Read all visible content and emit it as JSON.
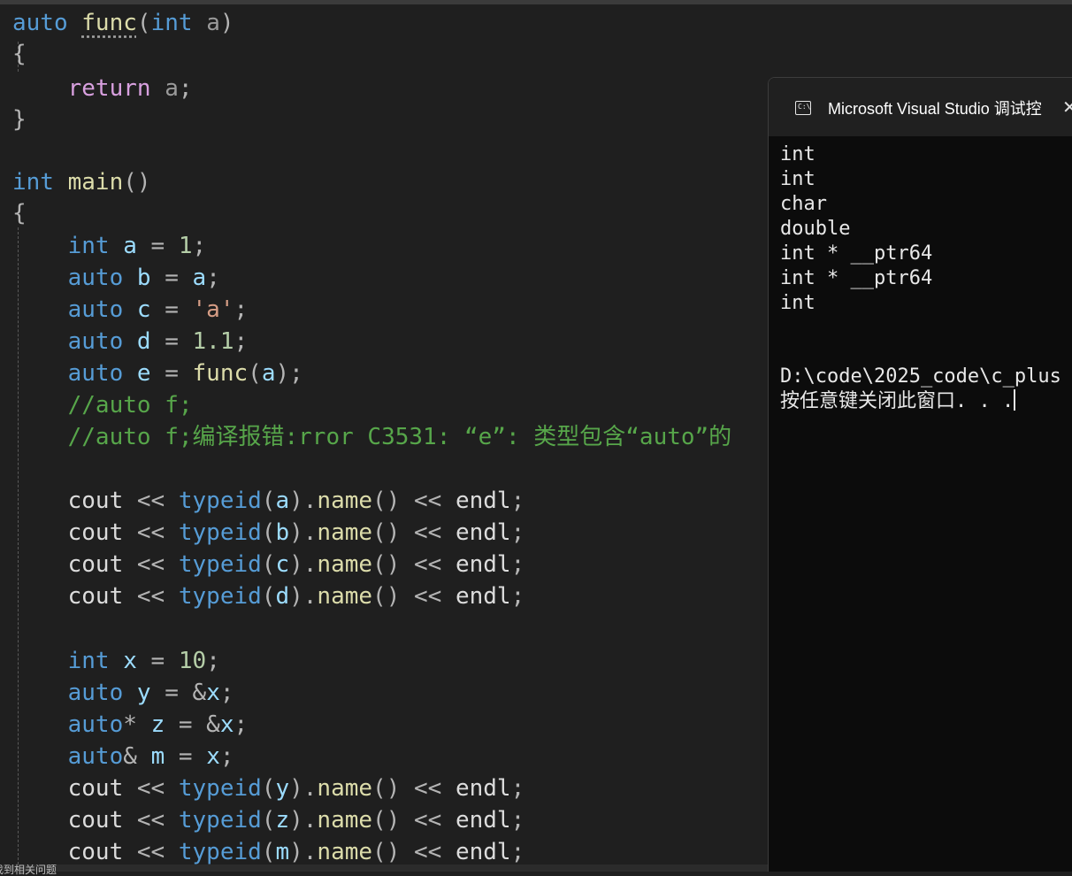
{
  "editor": {
    "lines": [
      [
        [
          "kw",
          "auto"
        ],
        [
          "plain",
          " "
        ],
        [
          "fn",
          "func",
          "squiggle"
        ],
        [
          "op",
          "("
        ],
        [
          "kw",
          "int"
        ],
        [
          "plain",
          " "
        ],
        [
          "param",
          "a"
        ],
        [
          "op",
          ")"
        ]
      ],
      [
        [
          "op",
          "{"
        ]
      ],
      [
        [
          "plain",
          "    "
        ],
        [
          "ctl",
          "return"
        ],
        [
          "plain",
          " "
        ],
        [
          "param",
          "a"
        ],
        [
          "op",
          ";"
        ]
      ],
      [
        [
          "op",
          "}"
        ]
      ],
      [],
      [
        [
          "kw",
          "int"
        ],
        [
          "plain",
          " "
        ],
        [
          "fn",
          "main"
        ],
        [
          "op",
          "()"
        ]
      ],
      [
        [
          "op",
          "{"
        ]
      ],
      [
        [
          "plain",
          "    "
        ],
        [
          "kw",
          "int"
        ],
        [
          "plain",
          " "
        ],
        [
          "var",
          "a"
        ],
        [
          "op",
          " = "
        ],
        [
          "num",
          "1"
        ],
        [
          "op",
          ";"
        ]
      ],
      [
        [
          "plain",
          "    "
        ],
        [
          "kw",
          "auto"
        ],
        [
          "plain",
          " "
        ],
        [
          "var",
          "b"
        ],
        [
          "op",
          " = "
        ],
        [
          "var",
          "a"
        ],
        [
          "op",
          ";"
        ]
      ],
      [
        [
          "plain",
          "    "
        ],
        [
          "kw",
          "auto"
        ],
        [
          "plain",
          " "
        ],
        [
          "var",
          "c"
        ],
        [
          "op",
          " = "
        ],
        [
          "str",
          "'a'"
        ],
        [
          "op",
          ";"
        ]
      ],
      [
        [
          "plain",
          "    "
        ],
        [
          "kw",
          "auto"
        ],
        [
          "plain",
          " "
        ],
        [
          "var",
          "d"
        ],
        [
          "op",
          " = "
        ],
        [
          "num",
          "1.1"
        ],
        [
          "op",
          ";"
        ]
      ],
      [
        [
          "plain",
          "    "
        ],
        [
          "kw",
          "auto"
        ],
        [
          "plain",
          " "
        ],
        [
          "var",
          "e"
        ],
        [
          "op",
          " = "
        ],
        [
          "fn",
          "func"
        ],
        [
          "op",
          "("
        ],
        [
          "var",
          "a"
        ],
        [
          "op",
          ");"
        ]
      ],
      [
        [
          "plain",
          "    "
        ],
        [
          "cmt",
          "//auto f;"
        ]
      ],
      [
        [
          "plain",
          "    "
        ],
        [
          "cmt",
          "//auto f;编译报错:rror C3531: “e”: 类型包含“auto”的"
        ]
      ],
      [],
      [
        [
          "plain",
          "    "
        ],
        [
          "plain",
          "cout"
        ],
        [
          "op",
          " << "
        ],
        [
          "kw",
          "typeid"
        ],
        [
          "op",
          "("
        ],
        [
          "var",
          "a"
        ],
        [
          "op",
          ")."
        ],
        [
          "fn",
          "name"
        ],
        [
          "op",
          "() << "
        ],
        [
          "plain",
          "endl"
        ],
        [
          "op",
          ";"
        ]
      ],
      [
        [
          "plain",
          "    "
        ],
        [
          "plain",
          "cout"
        ],
        [
          "op",
          " << "
        ],
        [
          "kw",
          "typeid"
        ],
        [
          "op",
          "("
        ],
        [
          "var",
          "b"
        ],
        [
          "op",
          ")."
        ],
        [
          "fn",
          "name"
        ],
        [
          "op",
          "() << "
        ],
        [
          "plain",
          "endl"
        ],
        [
          "op",
          ";"
        ]
      ],
      [
        [
          "plain",
          "    "
        ],
        [
          "plain",
          "cout"
        ],
        [
          "op",
          " << "
        ],
        [
          "kw",
          "typeid"
        ],
        [
          "op",
          "("
        ],
        [
          "var",
          "c"
        ],
        [
          "op",
          ")."
        ],
        [
          "fn",
          "name"
        ],
        [
          "op",
          "() << "
        ],
        [
          "plain",
          "endl"
        ],
        [
          "op",
          ";"
        ]
      ],
      [
        [
          "plain",
          "    "
        ],
        [
          "plain",
          "cout"
        ],
        [
          "op",
          " << "
        ],
        [
          "kw",
          "typeid"
        ],
        [
          "op",
          "("
        ],
        [
          "var",
          "d"
        ],
        [
          "op",
          ")."
        ],
        [
          "fn",
          "name"
        ],
        [
          "op",
          "() << "
        ],
        [
          "plain",
          "endl"
        ],
        [
          "op",
          ";"
        ]
      ],
      [],
      [
        [
          "plain",
          "    "
        ],
        [
          "kw",
          "int"
        ],
        [
          "plain",
          " "
        ],
        [
          "var",
          "x"
        ],
        [
          "op",
          " = "
        ],
        [
          "num",
          "10"
        ],
        [
          "op",
          ";"
        ]
      ],
      [
        [
          "plain",
          "    "
        ],
        [
          "kw",
          "auto"
        ],
        [
          "plain",
          " "
        ],
        [
          "var",
          "y"
        ],
        [
          "op",
          " = &"
        ],
        [
          "var",
          "x"
        ],
        [
          "op",
          ";"
        ]
      ],
      [
        [
          "plain",
          "    "
        ],
        [
          "kw",
          "auto"
        ],
        [
          "op",
          "* "
        ],
        [
          "var",
          "z"
        ],
        [
          "op",
          " = &"
        ],
        [
          "var",
          "x"
        ],
        [
          "op",
          ";"
        ]
      ],
      [
        [
          "plain",
          "    "
        ],
        [
          "kw",
          "auto"
        ],
        [
          "op",
          "& "
        ],
        [
          "var",
          "m"
        ],
        [
          "op",
          " = "
        ],
        [
          "var",
          "x"
        ],
        [
          "op",
          ";"
        ]
      ],
      [
        [
          "plain",
          "    "
        ],
        [
          "plain",
          "cout"
        ],
        [
          "op",
          " << "
        ],
        [
          "kw",
          "typeid"
        ],
        [
          "op",
          "("
        ],
        [
          "var",
          "y"
        ],
        [
          "op",
          ")."
        ],
        [
          "fn",
          "name"
        ],
        [
          "op",
          "() << "
        ],
        [
          "plain",
          "endl"
        ],
        [
          "op",
          ";"
        ]
      ],
      [
        [
          "plain",
          "    "
        ],
        [
          "plain",
          "cout"
        ],
        [
          "op",
          " << "
        ],
        [
          "kw",
          "typeid"
        ],
        [
          "op",
          "("
        ],
        [
          "var",
          "z"
        ],
        [
          "op",
          ")."
        ],
        [
          "fn",
          "name"
        ],
        [
          "op",
          "() << "
        ],
        [
          "plain",
          "endl"
        ],
        [
          "op",
          ";"
        ]
      ],
      [
        [
          "plain",
          "    "
        ],
        [
          "plain",
          "cout"
        ],
        [
          "op",
          " << "
        ],
        [
          "kw",
          "typeid"
        ],
        [
          "op",
          "("
        ],
        [
          "var",
          "m"
        ],
        [
          "op",
          ")."
        ],
        [
          "fn",
          "name"
        ],
        [
          "op",
          "() << "
        ],
        [
          "plain",
          "endl"
        ],
        [
          "op",
          ";"
        ]
      ]
    ],
    "bottom_text": "找到相关问题"
  },
  "console": {
    "title": "Microsoft Visual Studio 调试控",
    "close_glyph": "✕",
    "icon": "console-icon",
    "icon_prompt": "C:\\",
    "output_lines": [
      "int",
      "int",
      "char",
      "double",
      "int * __ptr64",
      "int * __ptr64",
      "int",
      "",
      "",
      "D:\\code\\2025_code\\c_plus",
      "按任意键关闭此窗口. . ."
    ]
  },
  "colors": {
    "keyword": "#569cd6",
    "control": "#d8a0df",
    "function": "#dcdcaa",
    "variable": "#9cdcfe",
    "number": "#b5cea8",
    "string": "#d69d85",
    "comment": "#57a64a",
    "editor_bg": "#1f1f1f",
    "console_bg": "#0c0c0c"
  }
}
